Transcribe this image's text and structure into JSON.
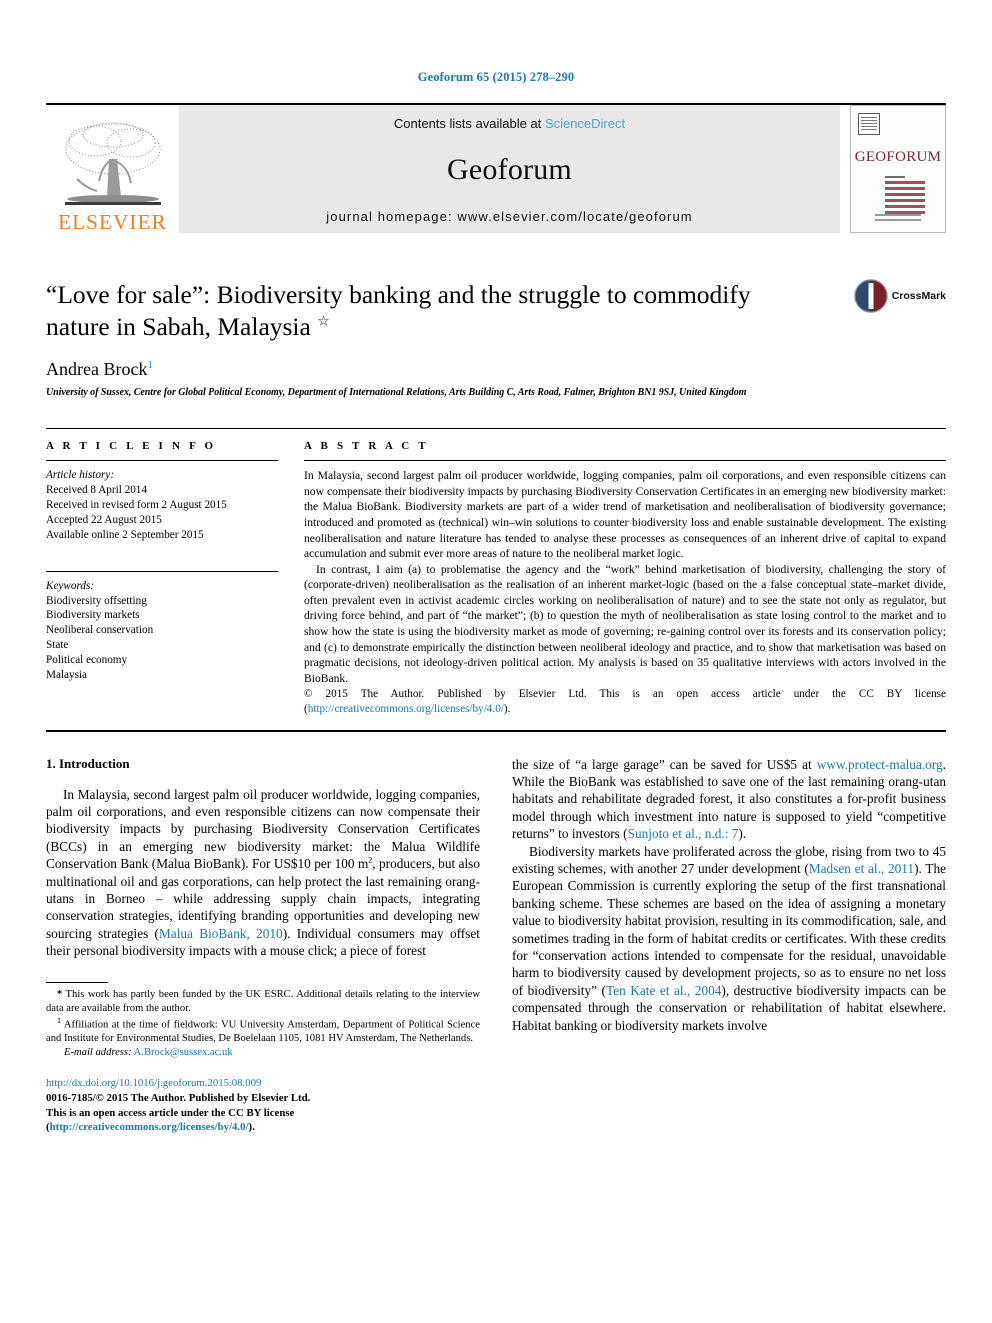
{
  "running_head": "Geoforum 65 (2015) 278–290",
  "masthead": {
    "contents_prefix": "Contents lists available at ",
    "sciencedirect": "ScienceDirect",
    "journal_name": "Geoforum",
    "homepage": "journal homepage: www.elsevier.com/locate/geoforum",
    "publisher": "ELSEVIER",
    "cover_title": "GEOFORUM"
  },
  "crossmark": {
    "label": "CrossMark"
  },
  "title": {
    "text": "“Love for sale”: Biodiversity banking and the struggle to commodify nature in Sabah, Malaysia ",
    "star": "☆"
  },
  "author": {
    "name": "Andrea Brock",
    "footnote_marker": "1"
  },
  "affiliation": "University of Sussex, Centre for Global Political Economy, Department of International Relations, Arts Building C, Arts Road, Falmer, Brighton BN1 9SJ, United Kingdom",
  "article_info": {
    "heading": "A R T I C L E   I N F O",
    "history_label": "Article history:",
    "history": [
      "Received 8 April 2014",
      "Received in revised form 2 August 2015",
      "Accepted 22 August 2015",
      "Available online 2 September 2015"
    ],
    "keywords_label": "Keywords:",
    "keywords": [
      "Biodiversity offsetting",
      "Biodiversity markets",
      "Neoliberal conservation",
      "State",
      "Political economy",
      "Malaysia"
    ]
  },
  "abstract": {
    "heading": "A B S T R A C T",
    "paragraph_1": "In Malaysia, second largest palm oil producer worldwide, logging companies, palm oil corporations, and even responsible citizens can now compensate their biodiversity impacts by purchasing Biodiversity Conservation Certificates in an emerging new biodiversity market: the Malua BioBank. Biodiversity markets are part of a wider trend of marketisation and neoliberalisation of biodiversity governance; introduced and promoted as (technical) win–win solutions to counter biodiversity loss and enable sustainable development. The existing neoliberalisation and nature literature has tended to analyse these processes as consequences of an inherent drive of capital to expand accumulation and submit ever more areas of nature to the neoliberal market logic.",
    "paragraph_2": "In contrast, I aim (a) to problematise the agency and the “work” behind marketisation of biodiversity, challenging the story of (corporate-driven) neoliberalisation as the realisation of an inherent market-logic (based on the a false conceptual state–market divide, often prevalent even in activist academic circles working on neoliberalisation of nature) and to see the state not only as regulator, but driving force behind, and part of “the market”; (b) to question the myth of neoliberalisation as state losing control to the market and to show how the state is using the biodiversity market as mode of governing; re-gaining control over its forests and its conservation policy; and (c) to demonstrate empirically the distinction between neoliberal ideology and practice, and to show that marketisation was based on pragmatic decisions, not ideology-driven political action. My analysis is based on 35 qualitative interviews with actors involved in the BioBank.",
    "copyright_text": "© 2015 The Author. Published by Elsevier Ltd. This is an open access article under the CC BY license (",
    "copyright_link": "http://creativecommons.org/licenses/by/4.0/",
    "copyright_tail": ")."
  },
  "section": {
    "heading": "1. Introduction"
  },
  "left_column": {
    "para_1_part1": "In Malaysia, second largest palm oil producer worldwide, logging companies, palm oil corporations, and even responsible citizens can now compensate their biodiversity impacts by purchasing Biodiversity Conservation Certificates (BCCs) in an emerging new biodiversity market: the Malua Wildlife Conservation Bank (Malua BioBank). For US$10 per 100 m",
    "para_1_sup": "2",
    "para_1_part2": ", producers, but also multinational oil and gas corporations, can help protect the last remaining orang-utans in Borneo – while addressing supply chain impacts, integrating conservation strategies, identifying branding opportunities and developing new sourcing strategies (",
    "para_1_cite": "Malua BioBank, 2010",
    "para_1_part3": "). Individual consumers may offset their personal biodiversity impacts with a mouse click; a piece of forest"
  },
  "right_column": {
    "para_1_part1": "the size of “a large garage” can be saved for US$5 at ",
    "para_1_link": "www.protect-malua.org",
    "para_1_part2": ". While the BioBank was established to save one of the last remaining orang-utan habitats and rehabilitate degraded forest, it also constitutes a for-profit business model through which investment into nature is supposed to yield “competitive returns” to investors (",
    "para_1_cite": "Sunjoto et al., n.d.: 7",
    "para_1_part3": ").",
    "para_2_part1": "Biodiversity markets have proliferated across the globe, rising from two to 45 existing schemes, with another 27 under development (",
    "para_2_cite1": "Madsen et al., 2011",
    "para_2_part2": "). The European Commission is currently exploring the setup of the first transnational banking scheme. These schemes are based on the idea of assigning a monetary value to biodiversity habitat provision, resulting in its commodification, sale, and sometimes trading in the form of habitat credits or certificates. With these credits for “conservation actions intended to compensate for the residual, unavoidable harm to biodiversity caused by development projects, so as to ensure no net loss of biodiversity” (",
    "para_2_cite2": "Ten Kate et al., 2004",
    "para_2_part3": "), destructive biodiversity impacts can be compensated through the conservation or rehabilitation of habitat elsewhere. Habitat banking or biodiversity markets involve"
  },
  "footnotes": {
    "star_marker": "*",
    "star_text": " This work has partly been funded by the UK ESRC. Additional details relating to the interview data are available from the author.",
    "one_marker": "1",
    "one_text": " Affiliation at the time of fieldwork: VU University Amsterdam, Department of Political Science and Institute for Environmental Studies, De Boelelaan 1105, 1081 HV Amsterdam, The Netherlands.",
    "email_label": "E-mail address:",
    "email": "A.Brock@sussex.ac.uk"
  },
  "page_footer": {
    "doi": "http://dx.doi.org/10.1016/j.geoforum.2015.08.009",
    "issn_line": "0016-7185/© 2015 The Author. Published by Elsevier Ltd.",
    "license_prefix": "This is an open access article under the CC BY license (",
    "license_link": "http://creativecommons.org/licenses/by/4.0/",
    "license_tail": ")."
  },
  "colors": {
    "link": "#1a7aa8",
    "sciencedirect": "#4aa3cd",
    "elsevier_orange": "#F57C20",
    "cover_maroon": "#7a2436"
  }
}
